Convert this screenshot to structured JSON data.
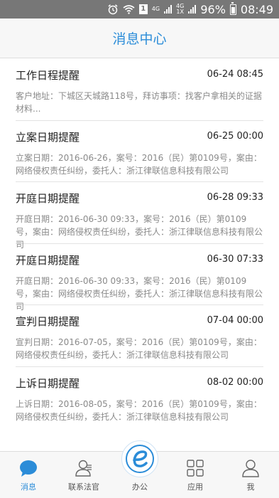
{
  "status_bar": {
    "network_a": "4G",
    "network_b": "4G",
    "network_b_sub": "1X",
    "sim_slot": "1",
    "battery": "96%",
    "time": "08:49"
  },
  "header": {
    "title": "消息中心"
  },
  "messages": [
    {
      "title": "工作日程提醒",
      "datetime": "06-24 08:45",
      "desc": "客户地址：下城区天城路118号，拜访事项：找客户拿相关的证据材料..."
    },
    {
      "title": "立案日期提醒",
      "datetime": "06-25 00:00",
      "desc": "立案日期：2016-06-26，案号：2016（民）第0109号，案由：网络侵权责任纠纷，委托人：浙江律联信息科技有限公司"
    },
    {
      "title": "开庭日期提醒",
      "datetime": "06-28 09:33",
      "desc": "开庭日期：2016-06-30 09:33，案号：2016（民）第0109号，案由：网络侵权责任纠纷，委托人：浙江律联信息科技有限公司"
    },
    {
      "title": "开庭日期提醒",
      "datetime": "06-30 07:33",
      "desc": "开庭日期：2016-06-30 09:33，案号：2016（民）第0109号，案由：网络侵权责任纠纷，委托人：浙江律联信息科技有限公司"
    },
    {
      "title": "宣判日期提醒",
      "datetime": "07-04 00:00",
      "desc": "宣判日期：2016-07-05，案号：2016（民）第0109号，案由：网络侵权责任纠纷，委托人：浙江律联信息科技有限公司"
    },
    {
      "title": "上诉日期提醒",
      "datetime": "08-02 00:00",
      "desc": "上诉日期：2016-08-05，案号：2016（民）第0109号，案由：网络侵权责任纠纷，委托人：浙江律联信息科技有限公司"
    }
  ],
  "tabbar": {
    "messages": {
      "label": "消息",
      "icon": "chat-bubble-icon"
    },
    "judges": {
      "label": "联系法官",
      "icon": "contact-judge-icon"
    },
    "office": {
      "label": "办公",
      "icon": "office-e-logo-icon"
    },
    "apps": {
      "label": "应用",
      "icon": "apps-grid-icon"
    },
    "me": {
      "label": "我",
      "icon": "user-icon"
    }
  },
  "colors": {
    "accent": "#2b8cd8",
    "status_bar": "#777777",
    "text": "#222222",
    "secondary_text": "#8a8a8a"
  }
}
